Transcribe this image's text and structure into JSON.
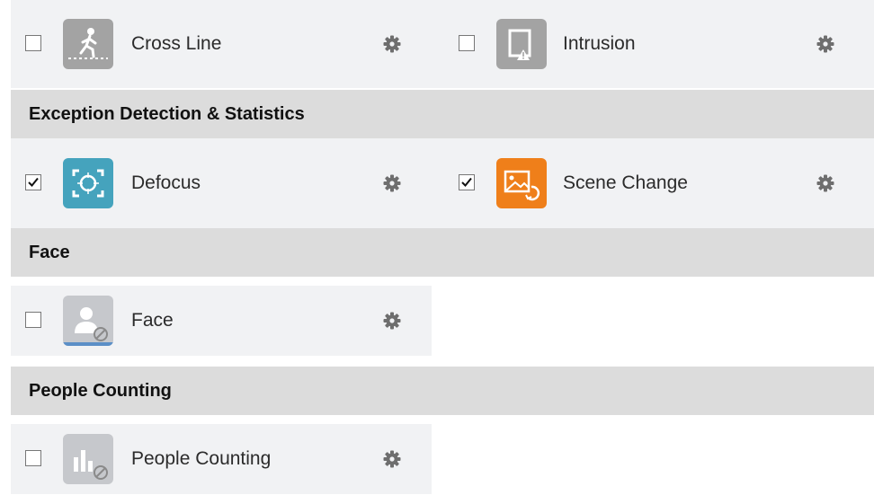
{
  "rows": [
    {
      "left": {
        "label": "Cross Line",
        "checked": false,
        "icon": "cross-line-icon",
        "tile_color": "#a3a3a3"
      },
      "right": {
        "label": "Intrusion",
        "checked": false,
        "icon": "intrusion-icon",
        "tile_color": "#a3a3a3"
      }
    }
  ],
  "sections": {
    "exception": {
      "title": "Exception Detection & Statistics",
      "left": {
        "label": "Defocus",
        "checked": true,
        "icon": "defocus-icon",
        "tile_color": "#45a3bd"
      },
      "right": {
        "label": "Scene Change",
        "checked": true,
        "icon": "scene-change-icon",
        "tile_color": "#ef7f1a"
      }
    },
    "face": {
      "title": "Face",
      "left": {
        "label": "Face",
        "checked": false,
        "icon": "face-disabled-icon",
        "tile_color": "#c6c8cc"
      }
    },
    "people_counting": {
      "title": "People Counting",
      "left": {
        "label": "People Counting",
        "checked": false,
        "icon": "people-counting-disabled-icon",
        "tile_color": "#c6c8cc"
      }
    }
  },
  "icons": {
    "settings": "gear-icon",
    "check": "checkmark-icon"
  },
  "colors": {
    "header_bg": "#dcdcdc",
    "row_bg": "#f1f2f4",
    "gear": "#6e6e6e"
  }
}
